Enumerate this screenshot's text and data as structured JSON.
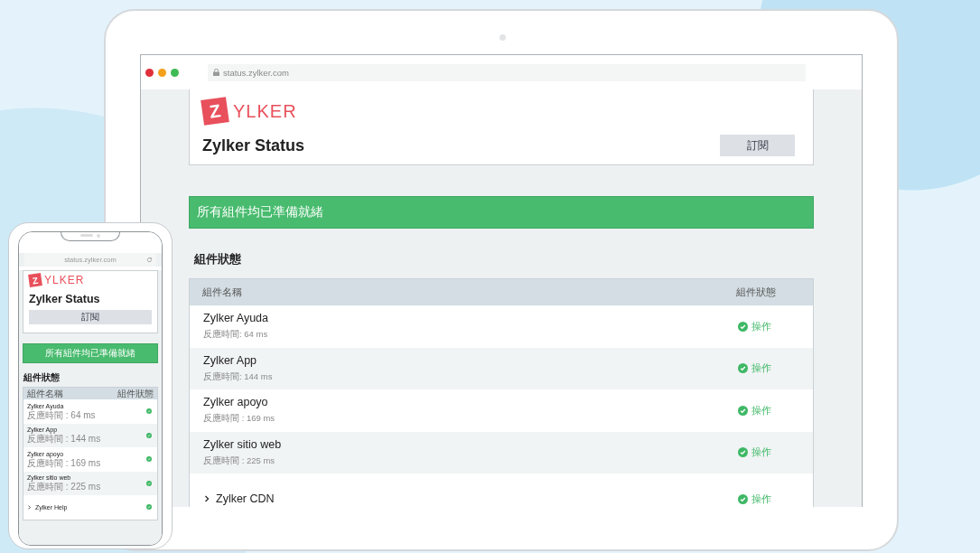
{
  "laptop": {
    "browser": {
      "url": "status.zylker.com"
    },
    "page": {
      "logo": {
        "mark": "Z",
        "text": "YLKER"
      },
      "title": "Zylker Status",
      "subscribe_button": "訂閱",
      "banner": "所有組件均已準備就緒",
      "section_title": "組件狀態",
      "table": {
        "columns": [
          "組件名稱",
          "組件狀態"
        ],
        "rows": [
          {
            "kind": "item",
            "name": "Zylker Ayuda",
            "response": "反應時間: 64 ms",
            "status": "操作"
          },
          {
            "kind": "item",
            "name": "Zylker App",
            "response": "反應時間: 144 ms",
            "status": "操作"
          },
          {
            "kind": "item",
            "name": "Zylker apoyo",
            "response": "反應時間 : 169 ms",
            "status": "操作"
          },
          {
            "kind": "item",
            "name": "Zylker sitio web",
            "response": "反應時間 : 225 ms",
            "status": "操作"
          },
          {
            "kind": "group",
            "name": "Zylker CDN",
            "expanded": false,
            "status": "操作"
          }
        ]
      }
    }
  },
  "phone": {
    "browser": {
      "url": "status.zylker.com"
    },
    "page": {
      "logo": {
        "mark": "Z",
        "text": "YLKER"
      },
      "title": "Zylker Status",
      "subscribe_button": "訂閱",
      "banner": "所有組件均已準備就緒",
      "section_title": "組件狀態",
      "table": {
        "columns": [
          "組件名稱",
          "組件狀態"
        ],
        "rows": [
          {
            "kind": "item",
            "name": "Zylker Ayuda",
            "response": "反應時間 : 64 ms"
          },
          {
            "kind": "item",
            "name": "Zylker App",
            "response": "反應時間 : 144 ms"
          },
          {
            "kind": "item",
            "name": "Zylker apoyo",
            "response": "反應時間 : 169 ms"
          },
          {
            "kind": "item",
            "name": "Zylker sitio web",
            "response": "反應時間 : 225 ms"
          },
          {
            "kind": "group",
            "name": "Zylker Help",
            "expanded": false
          }
        ]
      }
    }
  }
}
